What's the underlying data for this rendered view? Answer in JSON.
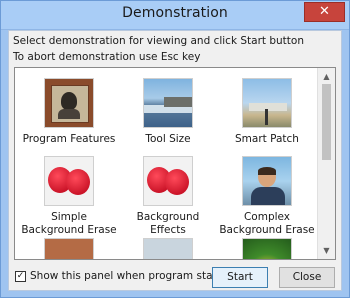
{
  "window": {
    "title": "Demonstration",
    "close_glyph": "✕"
  },
  "instructions": [
    "Select demonstration for viewing and click Start button",
    "To abort demonstration use Esc key"
  ],
  "demos": [
    {
      "label": "Program Features",
      "thumb": "program-features"
    },
    {
      "label": "Tool Size",
      "thumb": "tool-size"
    },
    {
      "label": "Smart Patch",
      "thumb": "smart-patch"
    },
    {
      "label": "Simple Background Erase",
      "thumb": "simple-background-erase"
    },
    {
      "label": "Background Effects",
      "thumb": "background-effects"
    },
    {
      "label": "Complex Background Erase",
      "thumb": "complex-background-erase"
    }
  ],
  "checkbox": {
    "label": "Show this panel when program starts",
    "checked": true,
    "check_glyph": "✓"
  },
  "buttons": {
    "start": "Start",
    "close": "Close"
  },
  "scrollbar": {
    "up": "▲",
    "down": "▼"
  }
}
